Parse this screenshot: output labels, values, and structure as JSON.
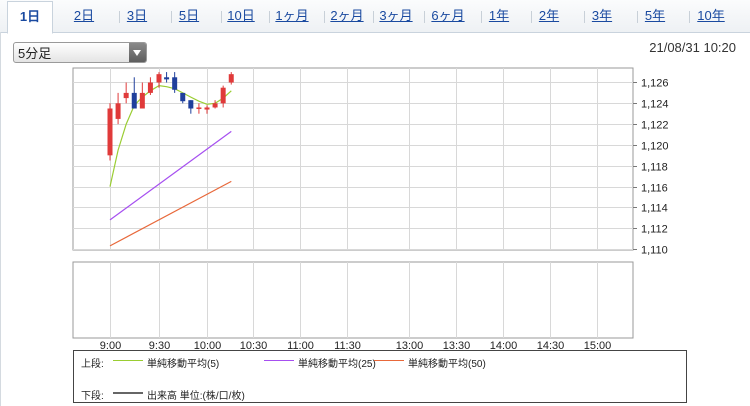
{
  "tabs": [
    {
      "label": "1日",
      "active": true
    },
    {
      "label": "2日"
    },
    {
      "label": "3日"
    },
    {
      "label": "5日"
    },
    {
      "label": "10日"
    },
    {
      "label": "1ヶ月"
    },
    {
      "label": "2ヶ月"
    },
    {
      "label": "3ヶ月"
    },
    {
      "label": "6ヶ月"
    },
    {
      "label": "1年"
    },
    {
      "label": "2年"
    },
    {
      "label": "3年"
    },
    {
      "label": "5年"
    },
    {
      "label": "10年"
    }
  ],
  "interval_select": {
    "value": "5分足"
  },
  "datetime": "21/08/31 10:20",
  "legend": {
    "upper_label": "上段:",
    "lower_label": "下段:",
    "sma5": "単純移動平均(5)",
    "sma25": "単純移動平均(25)",
    "sma50": "単純移動平均(50)",
    "volume": "出来高 単位:(株/口/枚)"
  },
  "colors": {
    "up": "#e03a3a",
    "down": "#1f3f9c",
    "sma5": "#9acd32",
    "sma25": "#a64ff0",
    "sma50": "#e8683a",
    "grid": "#d8d8d8",
    "active_tab_text": "#1a4aa0"
  },
  "chart_data": {
    "type": "candlestick",
    "xlim": [
      "9:00",
      "15:00"
    ],
    "x_ticks": [
      "9:00",
      "9:30",
      "10:00",
      "10:30",
      "11:00",
      "11:30",
      "13:00",
      "13:30",
      "14:00",
      "14:30",
      "15:00"
    ],
    "ylim": [
      1110,
      1127
    ],
    "y_ticks": [
      "1,110",
      "1,112",
      "1,114",
      "1,116",
      "1,118",
      "1,120",
      "1,122",
      "1,124",
      "1,126"
    ],
    "candles": [
      {
        "time": "9:00",
        "open": 1119,
        "high": 1124,
        "low": 1118.5,
        "close": 1123.5
      },
      {
        "time": "9:05",
        "open": 1122.5,
        "high": 1125,
        "low": 1122,
        "close": 1124
      },
      {
        "time": "9:10",
        "open": 1124.5,
        "high": 1126,
        "low": 1124,
        "close": 1125
      },
      {
        "time": "9:15",
        "open": 1125,
        "high": 1126.5,
        "low": 1123.5,
        "close": 1123.5
      },
      {
        "time": "9:20",
        "open": 1123.5,
        "high": 1126,
        "low": 1123.5,
        "close": 1125
      },
      {
        "time": "9:25",
        "open": 1125,
        "high": 1126.5,
        "low": 1124.8,
        "close": 1126
      },
      {
        "time": "9:30",
        "open": 1126,
        "high": 1127,
        "low": 1125.5,
        "close": 1126.8
      },
      {
        "time": "9:35",
        "open": 1126.5,
        "high": 1127,
        "low": 1126,
        "close": 1126.3
      },
      {
        "time": "9:40",
        "open": 1126.5,
        "high": 1127,
        "low": 1125,
        "close": 1125.3
      },
      {
        "time": "9:45",
        "open": 1125,
        "high": 1125,
        "low": 1124,
        "close": 1124.2
      },
      {
        "time": "9:50",
        "open": 1124.3,
        "high": 1124.3,
        "low": 1123,
        "close": 1123.5
      },
      {
        "time": "9:55",
        "open": 1123.5,
        "high": 1124,
        "low": 1123,
        "close": 1123.6
      },
      {
        "time": "10:00",
        "open": 1123.4,
        "high": 1123.8,
        "low": 1123,
        "close": 1123.6
      },
      {
        "time": "10:05",
        "open": 1123.6,
        "high": 1124.3,
        "low": 1123.5,
        "close": 1124
      },
      {
        "time": "10:10",
        "open": 1124,
        "high": 1125.7,
        "low": 1123.6,
        "close": 1125.5
      },
      {
        "time": "10:15",
        "open": 1126,
        "high": 1127,
        "low": 1125.8,
        "close": 1126.8
      }
    ],
    "series": [
      {
        "name": "単純移動平均(5)",
        "times": [
          "9:00",
          "9:05",
          "9:10",
          "9:15",
          "9:20",
          "9:25",
          "9:30",
          "9:35",
          "9:40",
          "9:45",
          "9:50",
          "9:55",
          "10:00",
          "10:05",
          "10:10",
          "10:15"
        ],
        "values": [
          1116,
          1119.5,
          1122,
          1123.8,
          1124.6,
          1125.2,
          1125.7,
          1125.6,
          1125.4,
          1125,
          1124.6,
          1124.2,
          1123.9,
          1124,
          1124.5,
          1125.2
        ]
      },
      {
        "name": "単純移動平均(25)",
        "times": [
          "9:00",
          "10:15"
        ],
        "values": [
          1112.8,
          1121.3
        ]
      },
      {
        "name": "単純移動平均(50)",
        "times": [
          "9:00",
          "10:15"
        ],
        "values": [
          1110.3,
          1116.5
        ]
      }
    ]
  }
}
